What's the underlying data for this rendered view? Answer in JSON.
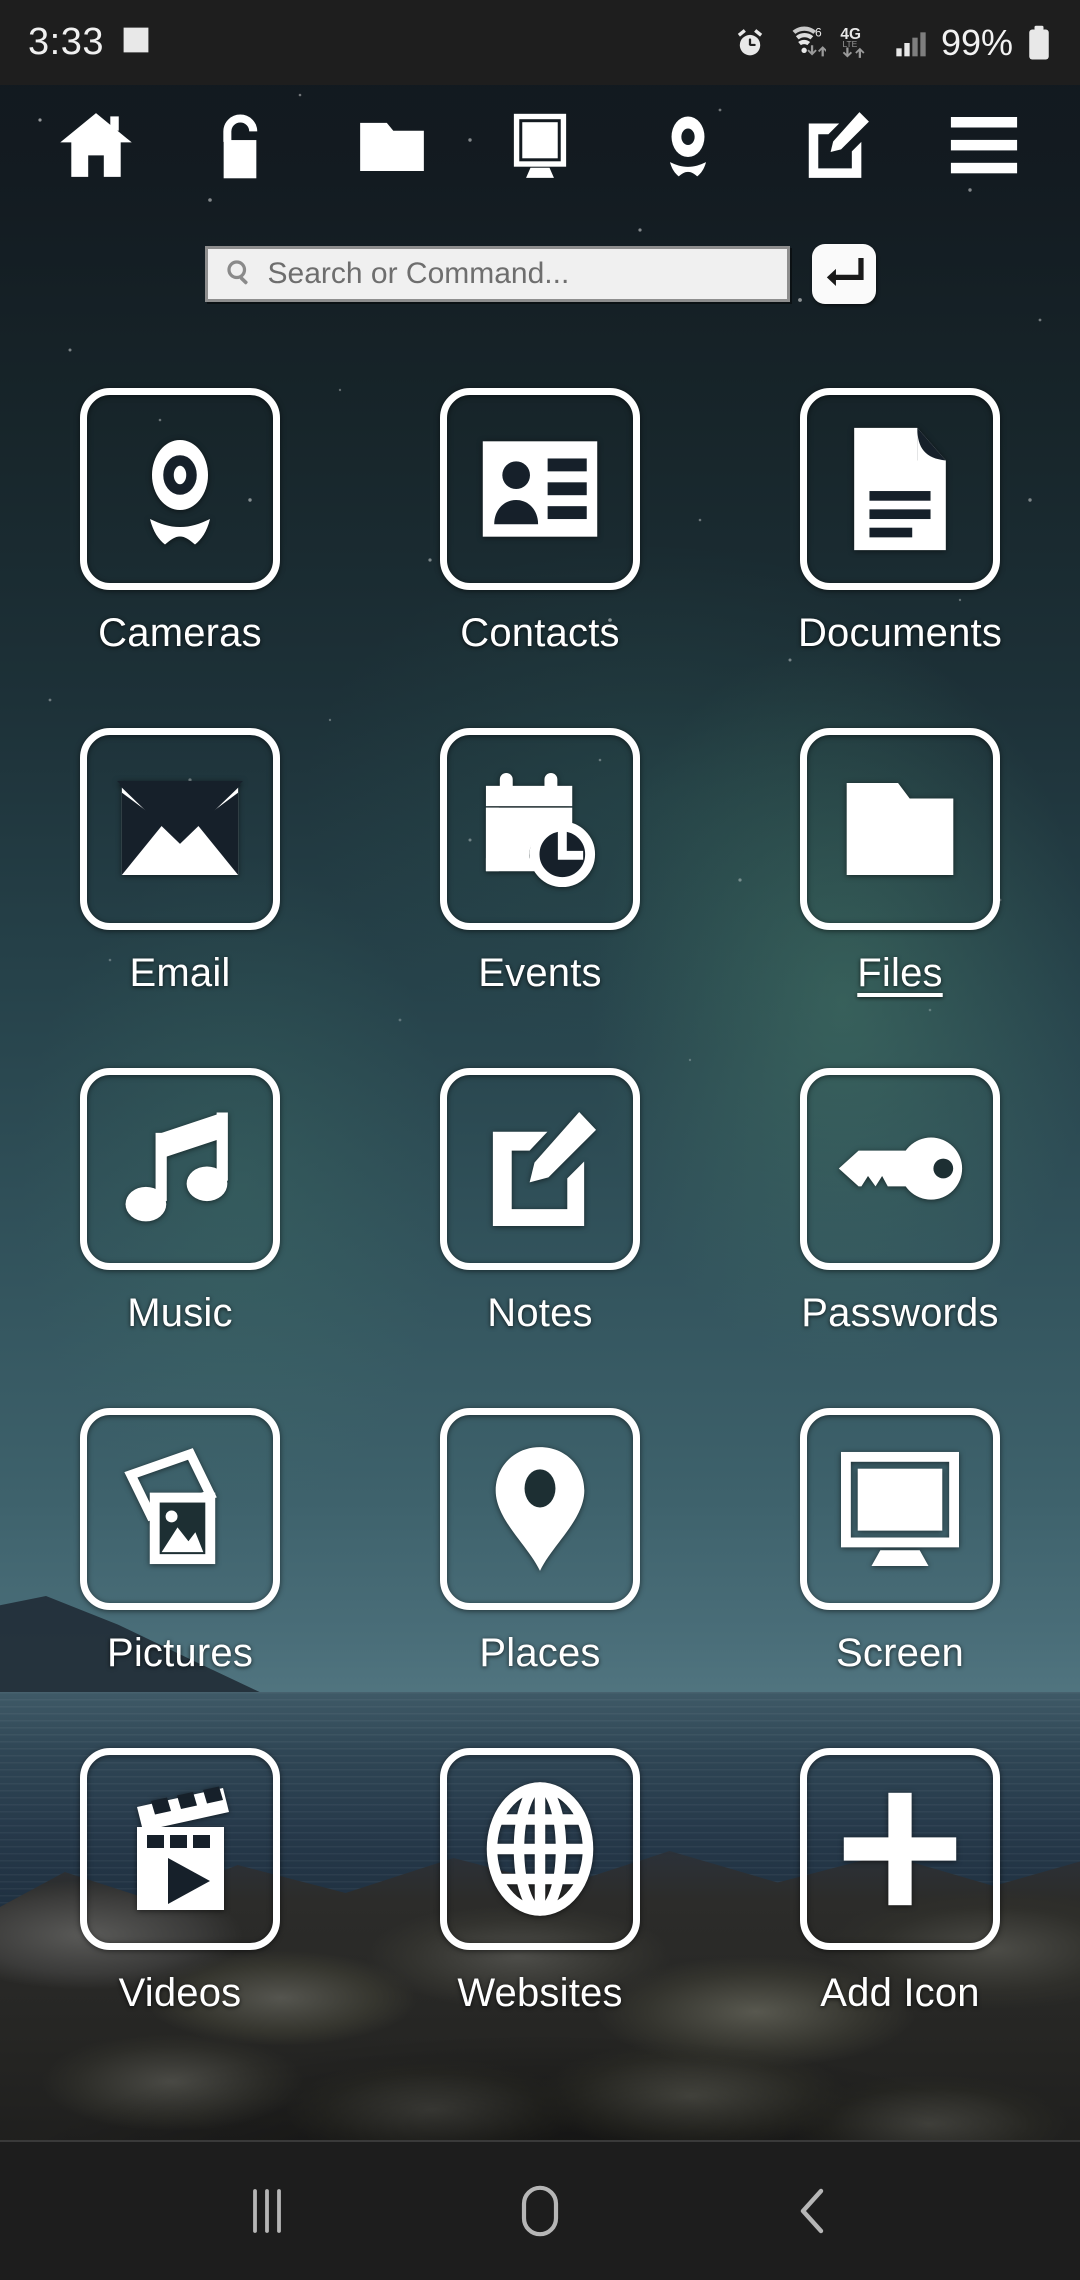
{
  "status_bar": {
    "time": "3:33",
    "left_icons": [
      {
        "name": "gallery-image-icon"
      }
    ],
    "right_icons": [
      {
        "name": "alarm-clock-icon"
      },
      {
        "name": "wifi-6-icon",
        "badge": "6"
      },
      {
        "name": "mobile-data-4g-lte-icon",
        "badge": "4G",
        "sub_badge": "LTE"
      },
      {
        "name": "cellular-signal-icon"
      }
    ],
    "battery_percent": "99%",
    "battery_icon": "battery-full-icon",
    "background_color": "#1e1e1e"
  },
  "toolbar": {
    "items": [
      {
        "name": "home-icon",
        "label": "Home"
      },
      {
        "name": "unlock-padlock-icon",
        "label": "Unlock"
      },
      {
        "name": "folder-icon",
        "label": "Folder"
      },
      {
        "name": "monitor-screen-icon",
        "label": "Screen"
      },
      {
        "name": "webcam-icon",
        "label": "Camera"
      },
      {
        "name": "note-edit-icon",
        "label": "Notes"
      },
      {
        "name": "hamburger-menu-icon",
        "label": "Menu"
      }
    ]
  },
  "search": {
    "placeholder": "Search or Command...",
    "value": "",
    "icon": "search-icon",
    "submit_icon": "enter-return-icon"
  },
  "apps": [
    {
      "label": "Cameras",
      "icon": "webcam-icon",
      "selected": false
    },
    {
      "label": "Contacts",
      "icon": "contact-card-icon",
      "selected": false
    },
    {
      "label": "Documents",
      "icon": "document-page-icon",
      "selected": false
    },
    {
      "label": "Email",
      "icon": "envelope-icon",
      "selected": false
    },
    {
      "label": "Events",
      "icon": "calendar-clock-icon",
      "selected": false
    },
    {
      "label": "Files",
      "icon": "folder-icon",
      "selected": true
    },
    {
      "label": "Music",
      "icon": "music-note-icon",
      "selected": false
    },
    {
      "label": "Notes",
      "icon": "note-edit-icon",
      "selected": false
    },
    {
      "label": "Passwords",
      "icon": "key-icon",
      "selected": false
    },
    {
      "label": "Pictures",
      "icon": "photos-stack-icon",
      "selected": false
    },
    {
      "label": "Places",
      "icon": "map-pin-icon",
      "selected": false
    },
    {
      "label": "Screen",
      "icon": "monitor-screen-icon",
      "selected": false
    },
    {
      "label": "Videos",
      "icon": "clapperboard-play-icon",
      "selected": false
    },
    {
      "label": "Websites",
      "icon": "globe-icon",
      "selected": false
    },
    {
      "label": "Add Icon",
      "icon": "plus-icon",
      "selected": false
    }
  ],
  "nav_bar": {
    "items": [
      {
        "name": "recents-icon",
        "label": "Recents"
      },
      {
        "name": "home-button-icon",
        "label": "Home"
      },
      {
        "name": "back-icon",
        "label": "Back"
      }
    ],
    "background_color": "#1d1d1d"
  },
  "theme": {
    "icon_stroke": "#ffffff",
    "label_color": "#ffffff",
    "search_bg": "#f0f0f0",
    "search_text": "#6e6e6e"
  }
}
